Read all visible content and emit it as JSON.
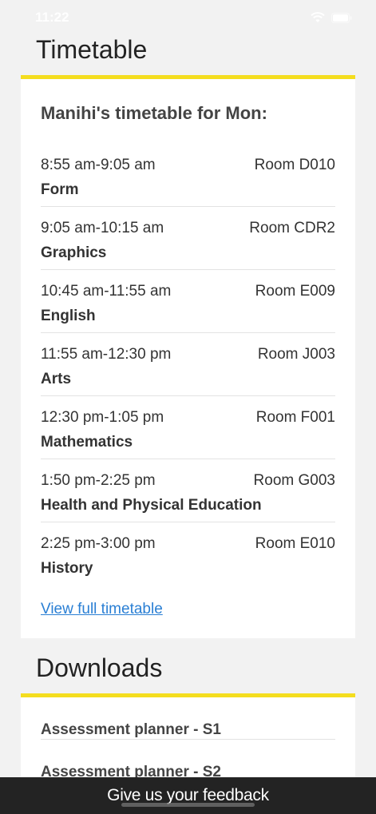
{
  "status_bar": {
    "time": "11:22"
  },
  "timetable": {
    "section_title": "Timetable",
    "heading": "Manihi's timetable for Mon:",
    "lessons": [
      {
        "time": "8:55 am-9:05 am",
        "room": "Room D010",
        "subject": "Form"
      },
      {
        "time": "9:05 am-10:15 am",
        "room": "Room CDR2",
        "subject": "Graphics"
      },
      {
        "time": "10:45 am-11:55 am",
        "room": "Room E009",
        "subject": "English"
      },
      {
        "time": "11:55 am-12:30 pm",
        "room": "Room J003",
        "subject": "Arts"
      },
      {
        "time": "12:30 pm-1:05 pm",
        "room": "Room F001",
        "subject": "Mathematics"
      },
      {
        "time": "1:50 pm-2:25 pm",
        "room": "Room G003",
        "subject": "Health and Physical Education"
      },
      {
        "time": "2:25 pm-3:00 pm",
        "room": "Room E010",
        "subject": "History"
      }
    ],
    "view_full_link": "View full timetable"
  },
  "downloads": {
    "section_title": "Downloads",
    "items": [
      {
        "label": "Assessment planner - S1"
      },
      {
        "label": "Assessment planner - S2"
      }
    ]
  },
  "feedback": {
    "label": "Give us your feedback"
  },
  "colors": {
    "accent": "#f4dd1e",
    "link": "#2a7fd4",
    "feedback_bar": "#232323",
    "background": "#f2f2f2"
  },
  "icons": [
    "wifi-icon",
    "battery-icon"
  ]
}
